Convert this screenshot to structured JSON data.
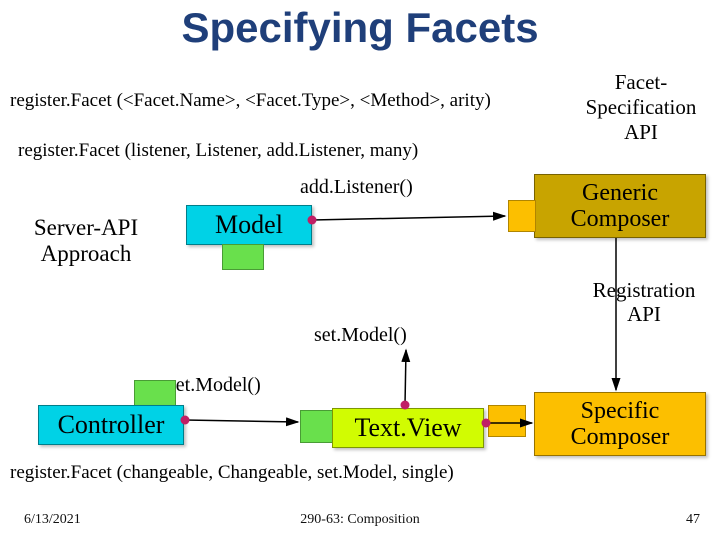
{
  "title": "Specifying Facets",
  "api_signature": "register.Facet (<Facet.Name>, <Facet.Type>, <Method>, arity)",
  "api_example_listener": "register.Facet (listener, Listener, add.Listener, many)",
  "api_example_changeable": "register.Facet  (changeable, Changeable, set.Model, single)",
  "labels": {
    "facet_spec_api": "Facet-\nSpecification\nAPI",
    "generic_composer": "Generic\nComposer",
    "specific_composer": "Specific\nComposer",
    "registration_api": "Registration\nAPI",
    "server_api": "Server-API\nApproach",
    "add_listener": "add.Listener()",
    "set_model": "set.Model()"
  },
  "boxes": {
    "model": "Model",
    "controller": "Controller",
    "textview": "Text.View"
  },
  "footer": {
    "date": "6/13/2021",
    "center": "290-63: Composition",
    "page": "47"
  }
}
